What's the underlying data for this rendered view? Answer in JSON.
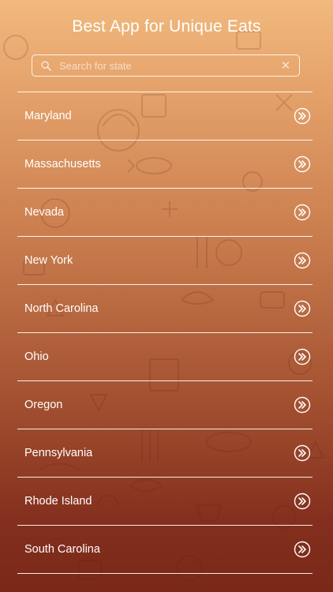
{
  "header": {
    "title": "Best App for Unique Eats"
  },
  "search": {
    "placeholder": "Search for state",
    "value": ""
  },
  "states": [
    "Maryland",
    "Massachusetts",
    "Nevada",
    "New York",
    "North Carolina",
    "Ohio",
    "Oregon",
    "Pennsylvania",
    "Rhode Island",
    "South Carolina"
  ],
  "icons": {
    "search": "search-icon",
    "clear": "clear-icon",
    "row_action": "double-chevron-right-icon"
  },
  "colors": {
    "gradient_top": "#f1b97d",
    "gradient_bottom": "#7a2818",
    "text": "#ffffff"
  }
}
